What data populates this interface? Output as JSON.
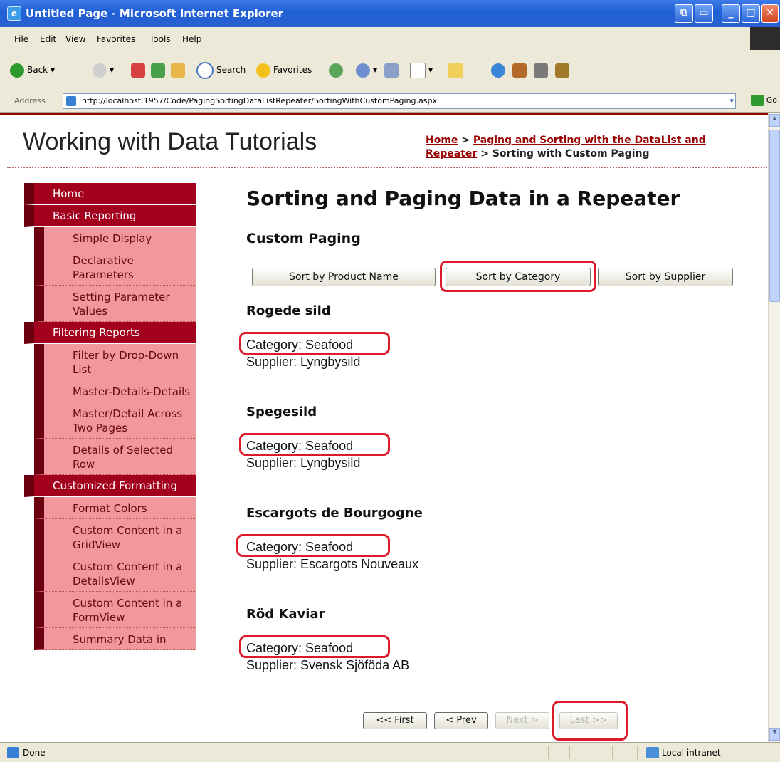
{
  "window": {
    "title": "Untitled Page - Microsoft Internet Explorer"
  },
  "menu": [
    "File",
    "Edit",
    "View",
    "Favorites",
    "Tools",
    "Help"
  ],
  "toolbar": {
    "back": "Back",
    "search": "Search",
    "favorites": "Favorites"
  },
  "address": {
    "label": "Address",
    "url": "http://localhost:1957/Code/PagingSortingDataListRepeater/SortingWithCustomPaging.aspx",
    "go": "Go"
  },
  "site": {
    "title": "Working with Data Tutorials"
  },
  "breadcrumb": {
    "home": "Home",
    "sep1": " > ",
    "parent": "Paging and Sorting with the DataList and Repeater",
    "sep2": " > ",
    "current": "Sorting with Custom Paging"
  },
  "sidebar": {
    "home": "Home",
    "basic": "Basic Reporting",
    "basic_items": [
      "Simple Display",
      "Declarative Parameters",
      "Setting Parameter Values"
    ],
    "filtering": "Filtering Reports",
    "filtering_items": [
      "Filter by Drop-Down List",
      "Master-Details-Details",
      "Master/Detail Across Two Pages",
      "Details of Selected Row"
    ],
    "custom": "Customized Formatting",
    "custom_items": [
      "Format Colors",
      "Custom Content in a GridView",
      "Custom Content in a DetailsView",
      "Custom Content in a FormView",
      "Summary Data in"
    ]
  },
  "main": {
    "heading": "Sorting and Paging Data in a Repeater",
    "subheading": "Custom Paging",
    "sort_buttons": [
      "Sort by Product Name",
      "Sort by Category",
      "Sort by Supplier"
    ],
    "products": [
      {
        "name": "Rogede sild",
        "category": "Category: Seafood",
        "supplier": "Supplier: Lyngbysild"
      },
      {
        "name": "Spegesild",
        "category": "Category: Seafood",
        "supplier": "Supplier: Lyngbysild"
      },
      {
        "name": "Escargots de Bourgogne",
        "category": "Category: Seafood",
        "supplier": "Supplier: Escargots Nouveaux"
      },
      {
        "name": "Röd Kaviar",
        "category": "Category: Seafood",
        "supplier": "Supplier: Svensk Sjöföda AB"
      }
    ],
    "pager": {
      "first": "<< First",
      "prev": "< Prev",
      "next": "Next >",
      "last": "Last >>"
    }
  },
  "status": {
    "text": "Done",
    "zone": "Local intranet"
  },
  "colors": {
    "accent": "#990000",
    "nav_section": "#a2001c",
    "nav_item": "#f0989c",
    "highlight": "#dd1a2a"
  }
}
